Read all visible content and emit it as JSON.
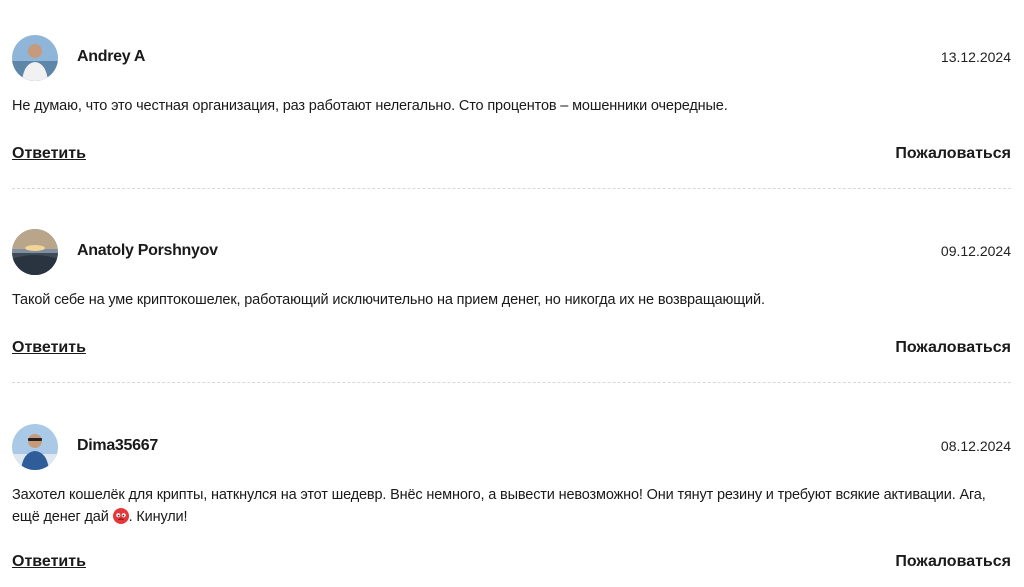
{
  "comments": [
    {
      "author": "Andrey A",
      "date": "13.12.2024",
      "text": "Не думаю, что это честная организация, раз работают нелегально. Сто процентов – мошенники очередные.",
      "reply_label": "Ответить",
      "report_label": "Пожаловаться"
    },
    {
      "author": "Anatoly Porshnyov",
      "date": "09.12.2024",
      "text": "Такой себе на уме криптокошелек, работающий исключительно на прием денег, но никогда их не возвращающий.",
      "reply_label": "Ответить",
      "report_label": "Пожаловаться"
    },
    {
      "author": "Dima35667",
      "date": "08.12.2024",
      "text_before_emoji": "Захотел кошелёк для крипты, наткнулся на этот шедевр. Внёс немного, а вывести невозможно! Они тянут резину и требуют всякие активации. Ага, ещё денег дай",
      "text_after_emoji": ". Кинули!",
      "emoji": "angry-face-icon",
      "reply_label": "Ответить",
      "report_label": "Пожаловаться"
    }
  ],
  "colors": {
    "text": "#1a1a1a",
    "divider": "#d8d8d8",
    "emoji": "#e5383b"
  }
}
